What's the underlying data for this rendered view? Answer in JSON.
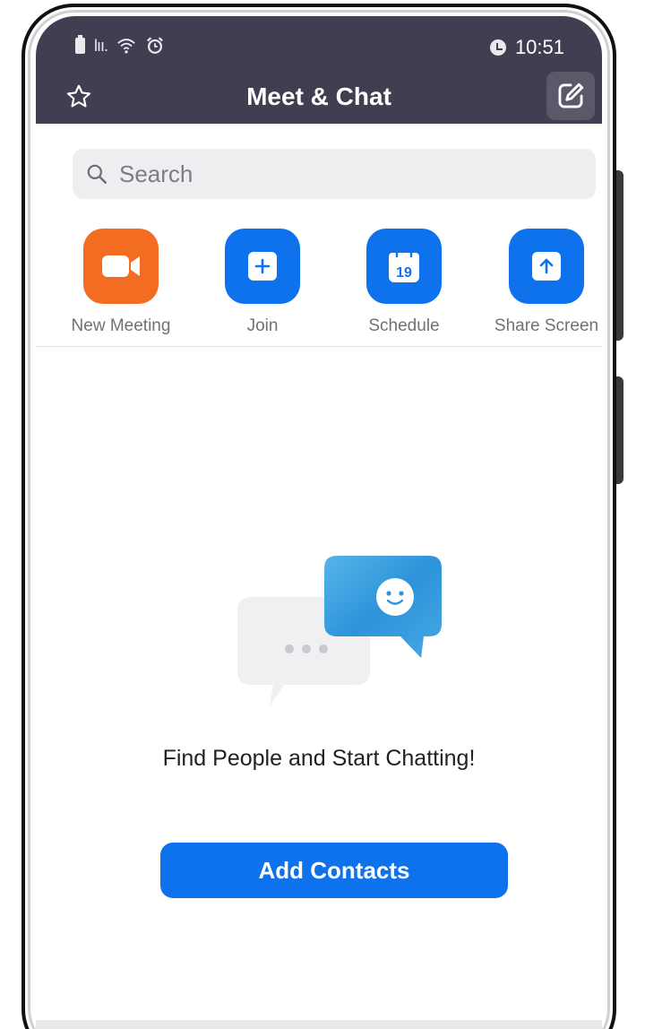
{
  "status_bar": {
    "time": "10:51",
    "signal_text": "lıı."
  },
  "header": {
    "title": "Meet & Chat"
  },
  "search": {
    "placeholder": "Search"
  },
  "actions": [
    {
      "label": "New Meeting",
      "icon": "video-camera-icon",
      "color": "#f26d21"
    },
    {
      "label": "Join",
      "icon": "plus-icon",
      "color": "#0e72ed"
    },
    {
      "label": "Schedule",
      "icon": "calendar-icon",
      "color": "#0e72ed",
      "calendar_day": "19"
    },
    {
      "label": "Share Screen",
      "icon": "upload-arrow-icon",
      "color": "#0e72ed"
    }
  ],
  "empty_state": {
    "message": "Find People and Start Chatting!",
    "button_label": "Add Contacts"
  },
  "colors": {
    "header_bg": "#3f3f51",
    "accent_blue": "#0e72ed",
    "accent_orange": "#f26d21"
  }
}
